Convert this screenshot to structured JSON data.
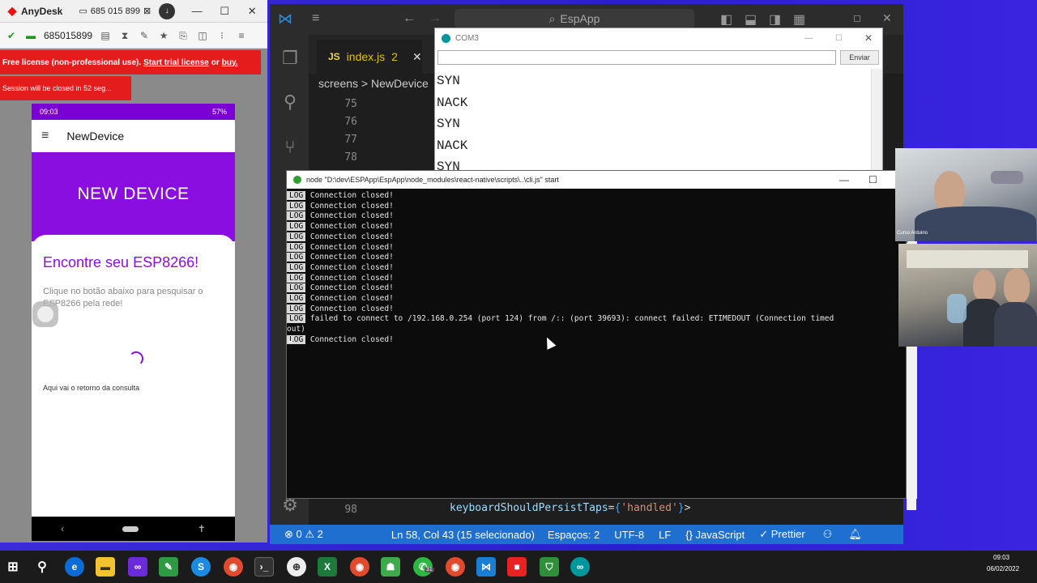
{
  "anydesk": {
    "app_name": "AnyDesk",
    "tab_id": "685 015 899",
    "connected_id": "685015899",
    "license_text_1": "Free license (non-professional use).",
    "license_link_1": "Start trial license",
    "license_or": "or",
    "license_link_2": "buy.",
    "session_text": "Session will be closed in 52 seg..."
  },
  "phone": {
    "status_time": "09:03",
    "status_battery": "57%",
    "appbar_title": "NewDevice",
    "header_title": "NEW DEVICE",
    "card_title": "Encontre seu ESP8266!",
    "card_desc": "Clique no botão abaixo para pesquisar o ESP8266 pela rede!",
    "result_text": "Aqui vai o retorno da consulta"
  },
  "vscode": {
    "search": "EspApp",
    "tab": {
      "lang": "JS",
      "name": "index.js",
      "count": "2",
      "close": "✕"
    },
    "breadcrumb": "screens > NewDevice",
    "line_numbers": [
      "75",
      "76",
      "77",
      "78"
    ],
    "line_98": "98",
    "code_98": {
      "attr": "keyboardShouldPersistTaps",
      "eq": "=",
      "ob": "{",
      "str": "'handled'",
      "cb": "}",
      "close": ">"
    },
    "status": {
      "problems": "⊗ 0 ⚠ 2",
      "position": "Ln 58, Col 43 (15 selecionado)",
      "spaces": "Espaços: 2",
      "encoding": "UTF-8",
      "eol": "LF",
      "language": "{} JavaScript",
      "prettier": "✓ Prettier"
    }
  },
  "serial": {
    "title": "COM3",
    "send_label": "Enviar",
    "lines": [
      "SYN",
      "NACK",
      "SYN",
      "NACK",
      "SYN"
    ]
  },
  "terminal": {
    "title": "node  \"D:\\dev\\ESPApp\\EspApp\\node_modules\\react-native\\scripts\\..\\cli.js\" start",
    "log_tag": "LOG",
    "closed_msg": "Connection closed!",
    "closed_count": 12,
    "error_line": "failed to connect to /192.168.0.254 (port 124) from /:: (port 39693): connect failed: ETIMEDOUT (Connection timed",
    "error_cont": "out)",
    "last_msg": "Connection closed!"
  },
  "video": {
    "cam1_label": "Curso Arduino"
  },
  "taskbar": {
    "time": "09:03",
    "date": "06/02/2022",
    "badge": "31"
  },
  "colors": {
    "vscode_status": "#1e6fd0",
    "phone_purple": "#8a0ee0",
    "anydesk_red": "#e51c1c"
  }
}
